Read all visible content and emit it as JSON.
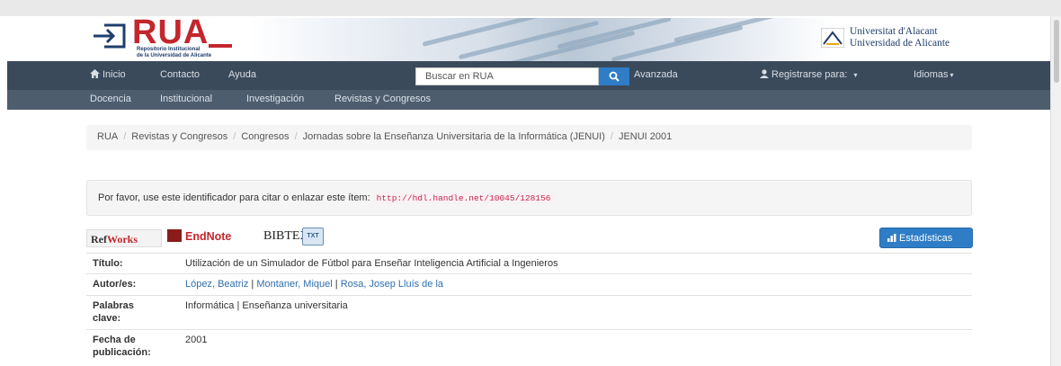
{
  "header": {
    "logo_text": "RUA",
    "logo_subtitle_1": "Repositorio Institucional",
    "logo_subtitle_2": "de la Universidad de Alicante",
    "university_name_1": "Universitat d'Alacant",
    "university_name_2": "Universidad de Alicante"
  },
  "navbar": {
    "home": "Inicio",
    "contact": "Contacto",
    "help": "Ayuda",
    "search_placeholder": "Buscar en RUA",
    "advanced": "Avanzada",
    "register": "Registrarse para:",
    "languages": "Idiomas"
  },
  "subnav": [
    "Docencia",
    "Institucional",
    "Investigación",
    "Revistas y Congresos"
  ],
  "breadcrumb": [
    "RUA",
    "Revistas y Congresos",
    "Congresos",
    "Jornadas sobre la Enseñanza Universitaria de la Informática (JENUI)",
    "JENUI 2001"
  ],
  "cite": {
    "text": "Por favor, use este identificador para citar o enlazar este ítem:",
    "handle": "http://hdl.handle.net/10045/128156"
  },
  "export": {
    "refworks_a": "Ref",
    "refworks_b": "Works",
    "endnote": "EndNote",
    "bibtex": "BIBTEX",
    "txt": "TXT"
  },
  "stats_button": "Estadísticas",
  "metadata": {
    "title_label": "Título:",
    "title_value": "Utilización de un Simulador de Fútbol para Enseñar Inteligencia Artificial a Ingenieros",
    "authors_label": "Autor/es:",
    "authors": [
      "López, Beatriz",
      "Montaner, Miquel",
      "Rosa, Josep Lluís de la"
    ],
    "keywords_label_1": "Palabras",
    "keywords_label_2": "clave:",
    "keywords_value": "Informática | Enseñanza universitaria",
    "date_label_1": "Fecha de",
    "date_label_2": "publicación:",
    "date_value": "2001"
  },
  "colors": {
    "brand_red": "#c3262c",
    "navbar": "#3b4a5b",
    "link": "#2f6fb0",
    "button_blue": "#2f7dc6"
  }
}
